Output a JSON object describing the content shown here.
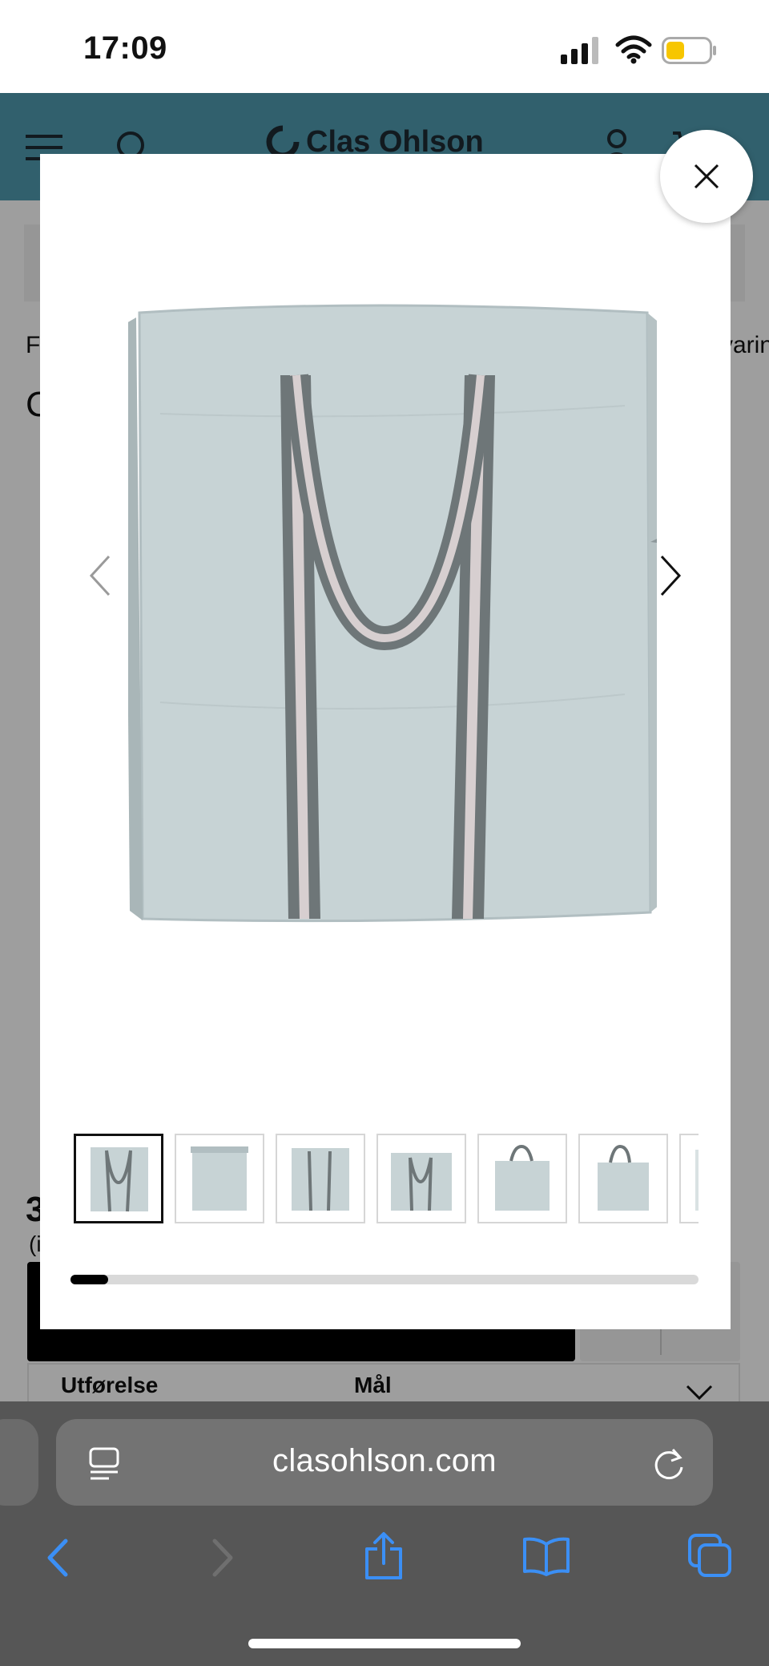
{
  "status_bar": {
    "time": "17:09"
  },
  "site": {
    "brand": "Clas Ohlson",
    "header_color": "#4f9cb1",
    "nav_left_fragment": "F",
    "nav_right_fragment": "varin",
    "title_fragment": "C",
    "price_fragment": "3",
    "price_note_fragment": "(i",
    "spec_labels": [
      "Utførelse",
      "Mål"
    ]
  },
  "gallery": {
    "thumbnail_count": 7,
    "active_index": 0,
    "progress": 0.06,
    "icons": {
      "close": "close-icon",
      "prev": "chevron-left-icon",
      "next": "chevron-right-icon"
    }
  },
  "browser": {
    "url": "clasohlson.com",
    "accent_color": "#3b8ff5"
  }
}
